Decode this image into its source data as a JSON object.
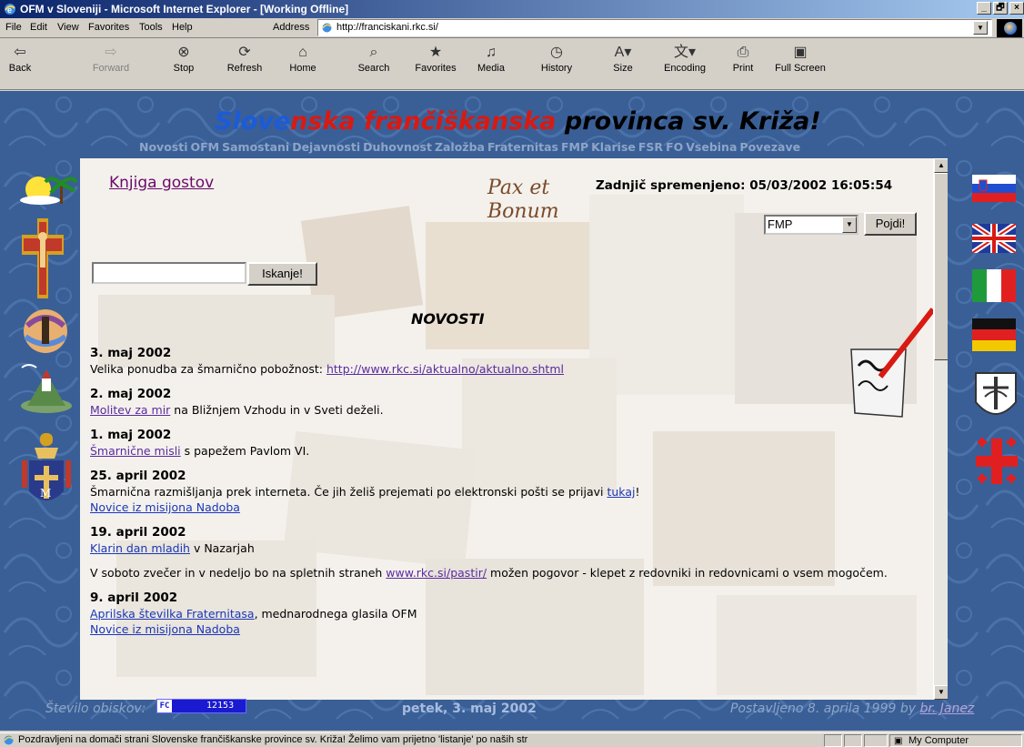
{
  "window": {
    "title": "OFM v Sloveniji - Microsoft Internet Explorer - [Working Offline]",
    "controls": [
      "_",
      "🗗",
      "×"
    ]
  },
  "menu": {
    "items": [
      "File",
      "Edit",
      "View",
      "Favorites",
      "Tools",
      "Help"
    ],
    "address_label": "Address",
    "address_url": "http://franciskani.rkc.si/"
  },
  "toolbar": {
    "buttons": [
      {
        "label": "Back",
        "icon": "back-arrow-icon"
      },
      {
        "label": "Forward",
        "icon": "forward-arrow-icon"
      },
      {
        "label": "Stop",
        "icon": "stop-icon"
      },
      {
        "label": "Refresh",
        "icon": "refresh-icon"
      },
      {
        "label": "Home",
        "icon": "home-icon"
      },
      {
        "label": "Search",
        "icon": "search-icon"
      },
      {
        "label": "Favorites",
        "icon": "favorites-icon"
      },
      {
        "label": "Media",
        "icon": "media-icon"
      },
      {
        "label": "History",
        "icon": "history-icon"
      },
      {
        "label": "Size",
        "icon": "text-size-icon"
      },
      {
        "label": "Encoding",
        "icon": "encoding-icon"
      },
      {
        "label": "Print",
        "icon": "print-icon"
      },
      {
        "label": "Full Screen",
        "icon": "full-screen-icon"
      }
    ]
  },
  "site": {
    "title_parts": [
      "Slove",
      "nska",
      " frančiškanska",
      " provinca sv. Križa!"
    ],
    "nav": [
      "Novosti",
      "OFM",
      "Samostani",
      "Dejavnosti",
      "Duhovnost",
      "Založba",
      "Fraternitas",
      "FMP",
      "Klarise",
      "FSR",
      "FO",
      "Vsebina",
      "Povezave"
    ]
  },
  "content": {
    "guestbook_link": "Knjiga gostov",
    "pax_line1": "Pax et",
    "pax_line2": "Bonum",
    "last_modified": "Zadnjič spremenjeno: 05/03/2002 16:05:54",
    "select_value": "FMP",
    "go_button": "Pojdi!",
    "search_value": "",
    "search_button": "Iskanje!",
    "section_heading": "NOVOSTI"
  },
  "news": [
    {
      "date": "3. maj 2002",
      "text_before": "Velika ponudba za šmarnično pobožnost: ",
      "link": "http://www.rkc.si/aktualno/aktualno.shtml",
      "text_after": ""
    },
    {
      "date": "2. maj 2002",
      "link": "Molitev za mir",
      "text_after": " na Bližnjem Vzhodu in v Sveti deželi."
    },
    {
      "date": "1. maj 2002",
      "link": "Šmarnične misli",
      "text_after": " s papežem Pavlom VI."
    },
    {
      "date": "25. april 2002",
      "text_before": "Šmarnična razmišljanja prek interneta. Če jih želiš prejemati po elektronski pošti se prijavi ",
      "link": "tukaj",
      "text_after": "!",
      "link2": "Novice iz misijona Nadoba"
    },
    {
      "date": "19. april 2002",
      "link": "Klarin dan mladih",
      "text_after": " v Nazarjah",
      "para_before": "V soboto zvečer in v nedeljo bo na spletnih straneh ",
      "para_link": "www.rkc.si/pastir/",
      "para_after": " možen pogovor - klepet z redovniki in redovnicami o vsem mogočem."
    },
    {
      "date": "9. april 2002",
      "link": "Aprilska številka Fraternitasa",
      "text_after": ", mednarodnega glasila OFM",
      "link2": "Novice iz misijona Nadoba"
    }
  ],
  "footer": {
    "counter_label": "Število obiskov:",
    "counter_prefix": "FC",
    "counter_value": "12153",
    "date": "petek, 3. maj 2002",
    "posted_prefix": "Postavljeno 8. aprila 1999 by ",
    "posted_author": "br. Janez"
  },
  "status": {
    "text": "Pozdravljeni na domači strani Slovenske frančiškanske province sv. Križa!        Želimo vam prijetno 'listanje' po naših str",
    "zone": "My Computer"
  },
  "colors": {
    "page_bg": "#3a5f96",
    "title_blue": "#1c5bd8",
    "title_red": "#d81a12",
    "link_visited": "#5a2aa0",
    "link_blue": "#1a36b8",
    "nav_text": "#8ea5c8"
  }
}
